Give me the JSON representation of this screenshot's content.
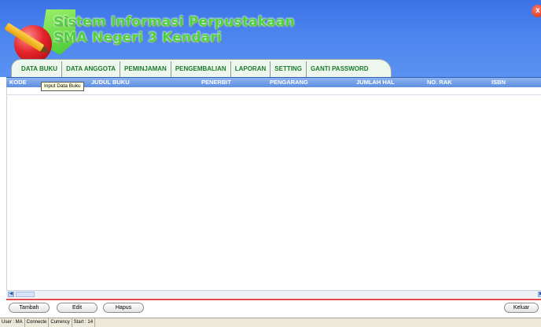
{
  "header": {
    "title_line1": "Sistem Informasi Perpustakaan",
    "title_line2": "SMA Negeri 3 Kendari",
    "close_glyph": "x",
    "logo_icon": "book-pencil-logo"
  },
  "tabs": [
    {
      "label": "DATA BUKU"
    },
    {
      "label": "DATA ANGGOTA"
    },
    {
      "label": "PEMINJAMAN"
    },
    {
      "label": "PENGEMBALIAN"
    },
    {
      "label": "LAPORAN"
    },
    {
      "label": "SETTING"
    },
    {
      "label": "GANTI PASSWORD"
    }
  ],
  "grid": {
    "columns": [
      {
        "label": "KODE"
      },
      {
        "label": "JUDUL BUKU"
      },
      {
        "label": "PENERBIT"
      },
      {
        "label": "PENGARANG"
      },
      {
        "label": "JUMLAH HAL"
      },
      {
        "label": "NO. RAK"
      },
      {
        "label": "ISBN"
      }
    ],
    "rows": []
  },
  "tooltip": "Input Data Buku",
  "buttons": {
    "tambah": "Tambah",
    "edit": "Edit",
    "hapus": "Hapus",
    "keluar": "Keluar"
  },
  "statusbar": {
    "user": "User : MA",
    "connect": "Connecte",
    "currency": "Currency",
    "start": "Start : 14"
  },
  "colors": {
    "header_blue": "#4a83ee",
    "title_green": "#4ed13a",
    "tab_text_green": "#1b7a2c",
    "grid_header_blue": "#5d8ee0",
    "accent_red": "#e24b4b"
  }
}
